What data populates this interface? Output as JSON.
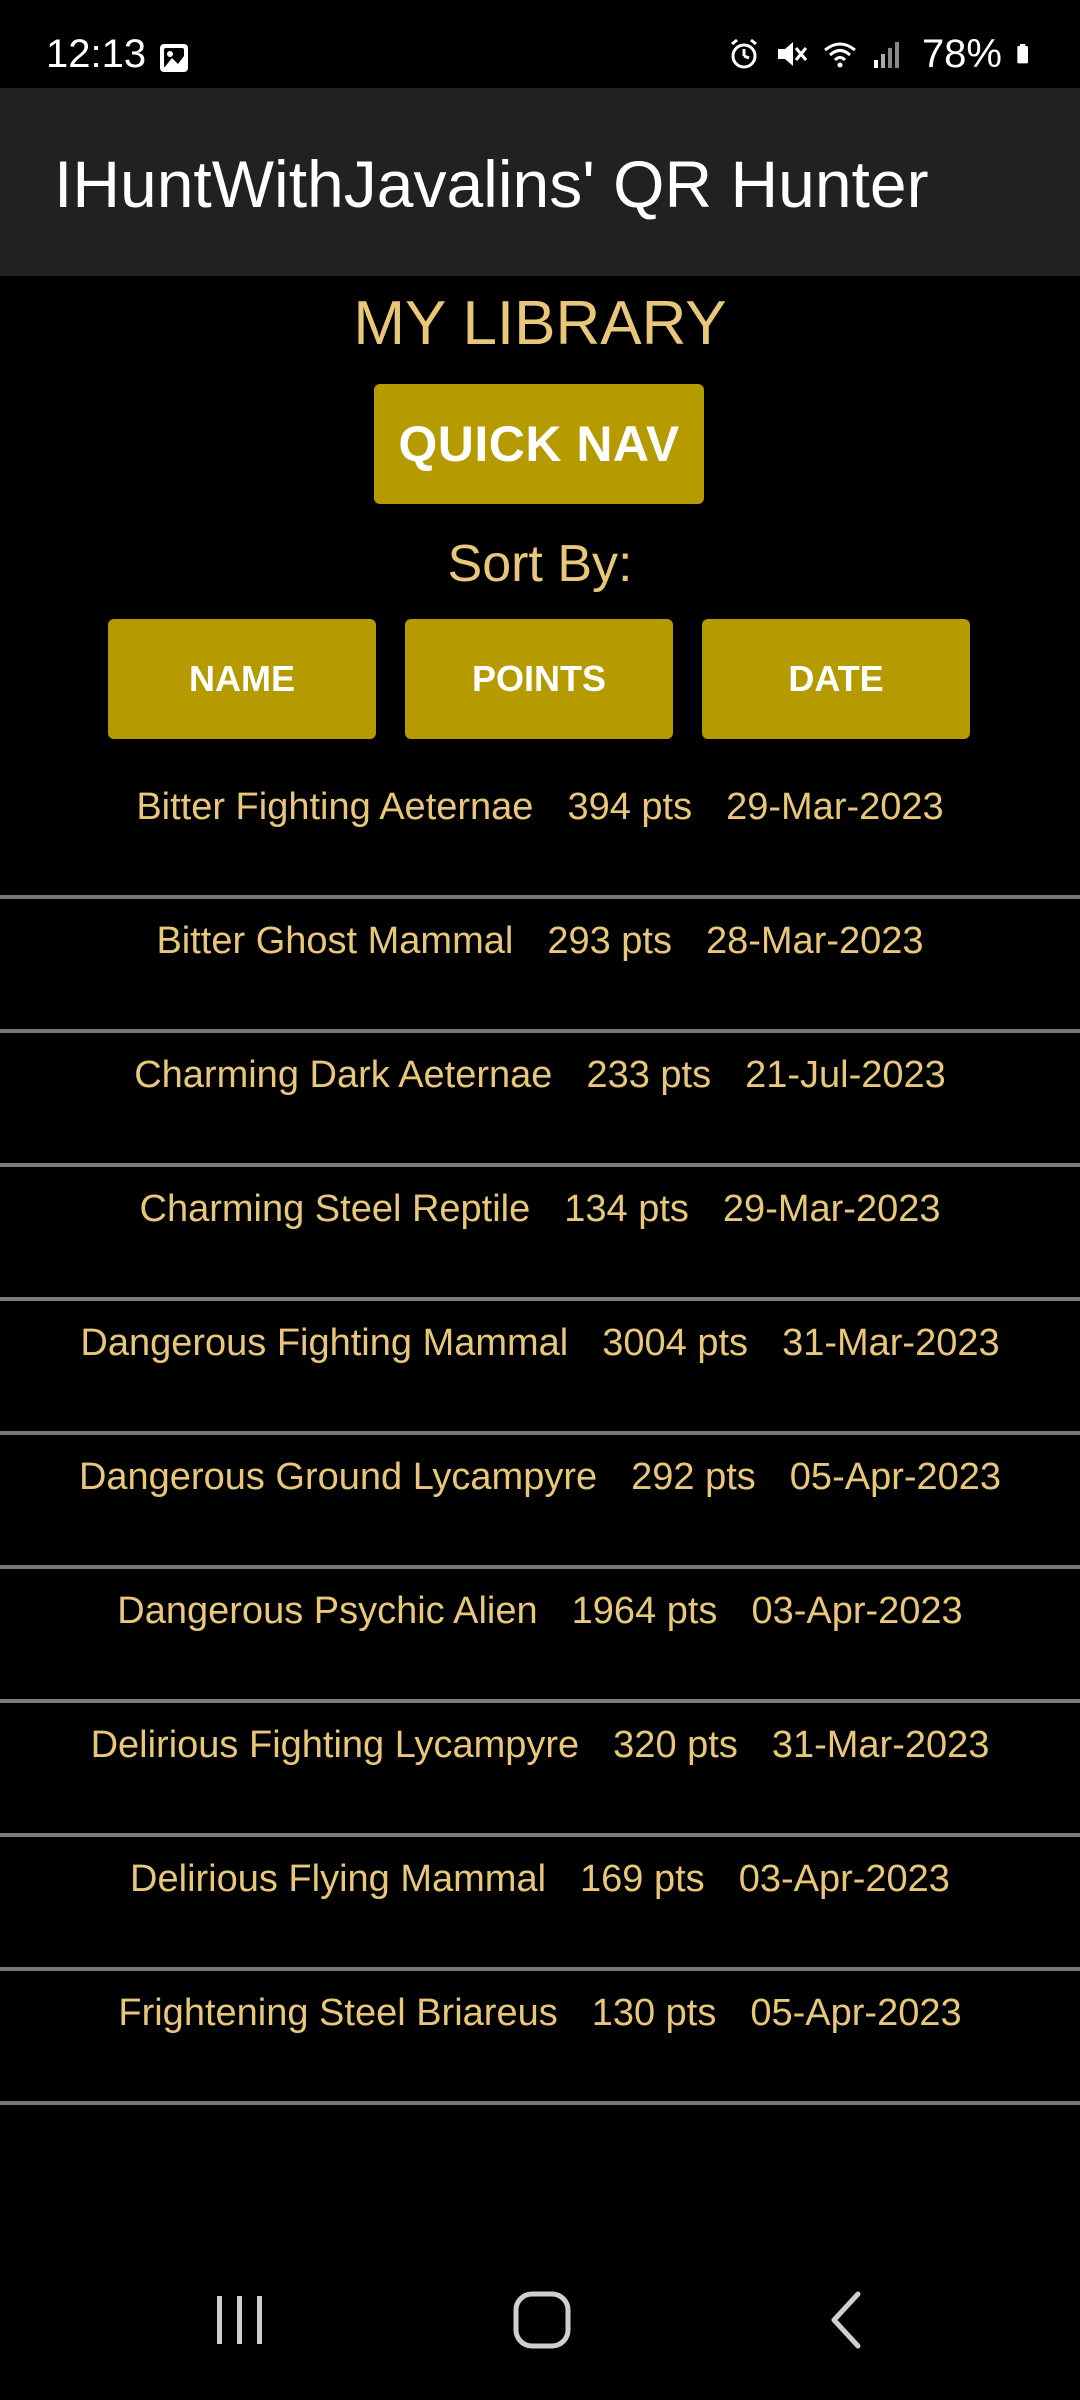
{
  "status_bar": {
    "time": "12:13",
    "left_icon": "image-icon",
    "right_icons": [
      "alarm-icon",
      "mute-icon",
      "wifi-icon",
      "signal-icon"
    ],
    "battery_text": "78%",
    "battery_icon": "battery-icon"
  },
  "app_bar": {
    "title": "IHuntWithJavalins' QR Hunter",
    "background": "#212121"
  },
  "library": {
    "title": "MY LIBRARY",
    "quick_nav_label": "QUICK NAV",
    "sort_label": "Sort By:",
    "sort_buttons": {
      "name": "NAME",
      "points": "POINTS",
      "date": "DATE"
    },
    "accent_color": "#b59a00",
    "text_color": "#e8c77a"
  },
  "items": [
    {
      "name": "Bitter Fighting Aeternae",
      "points": "394 pts",
      "date": "29-Mar-2023"
    },
    {
      "name": "Bitter Ghost Mammal",
      "points": "293 pts",
      "date": "28-Mar-2023"
    },
    {
      "name": "Charming Dark Aeternae",
      "points": "233 pts",
      "date": "21-Jul-2023"
    },
    {
      "name": "Charming Steel Reptile",
      "points": "134 pts",
      "date": "29-Mar-2023"
    },
    {
      "name": "Dangerous Fighting Mammal",
      "points": "3004 pts",
      "date": "31-Mar-2023"
    },
    {
      "name": "Dangerous Ground Lycampyre",
      "points": "292 pts",
      "date": "05-Apr-2023"
    },
    {
      "name": "Dangerous Psychic Alien",
      "points": "1964 pts",
      "date": "03-Apr-2023"
    },
    {
      "name": "Delirious Fighting Lycampyre",
      "points": "320 pts",
      "date": "31-Mar-2023"
    },
    {
      "name": "Delirious Flying Mammal",
      "points": "169 pts",
      "date": "03-Apr-2023"
    },
    {
      "name": "Frightening Steel Briareus",
      "points": "130 pts",
      "date": "05-Apr-2023"
    }
  ],
  "nav_bar": {
    "recents_icon": "recents-icon",
    "home_icon": "home-icon",
    "back_icon": "back-icon"
  }
}
